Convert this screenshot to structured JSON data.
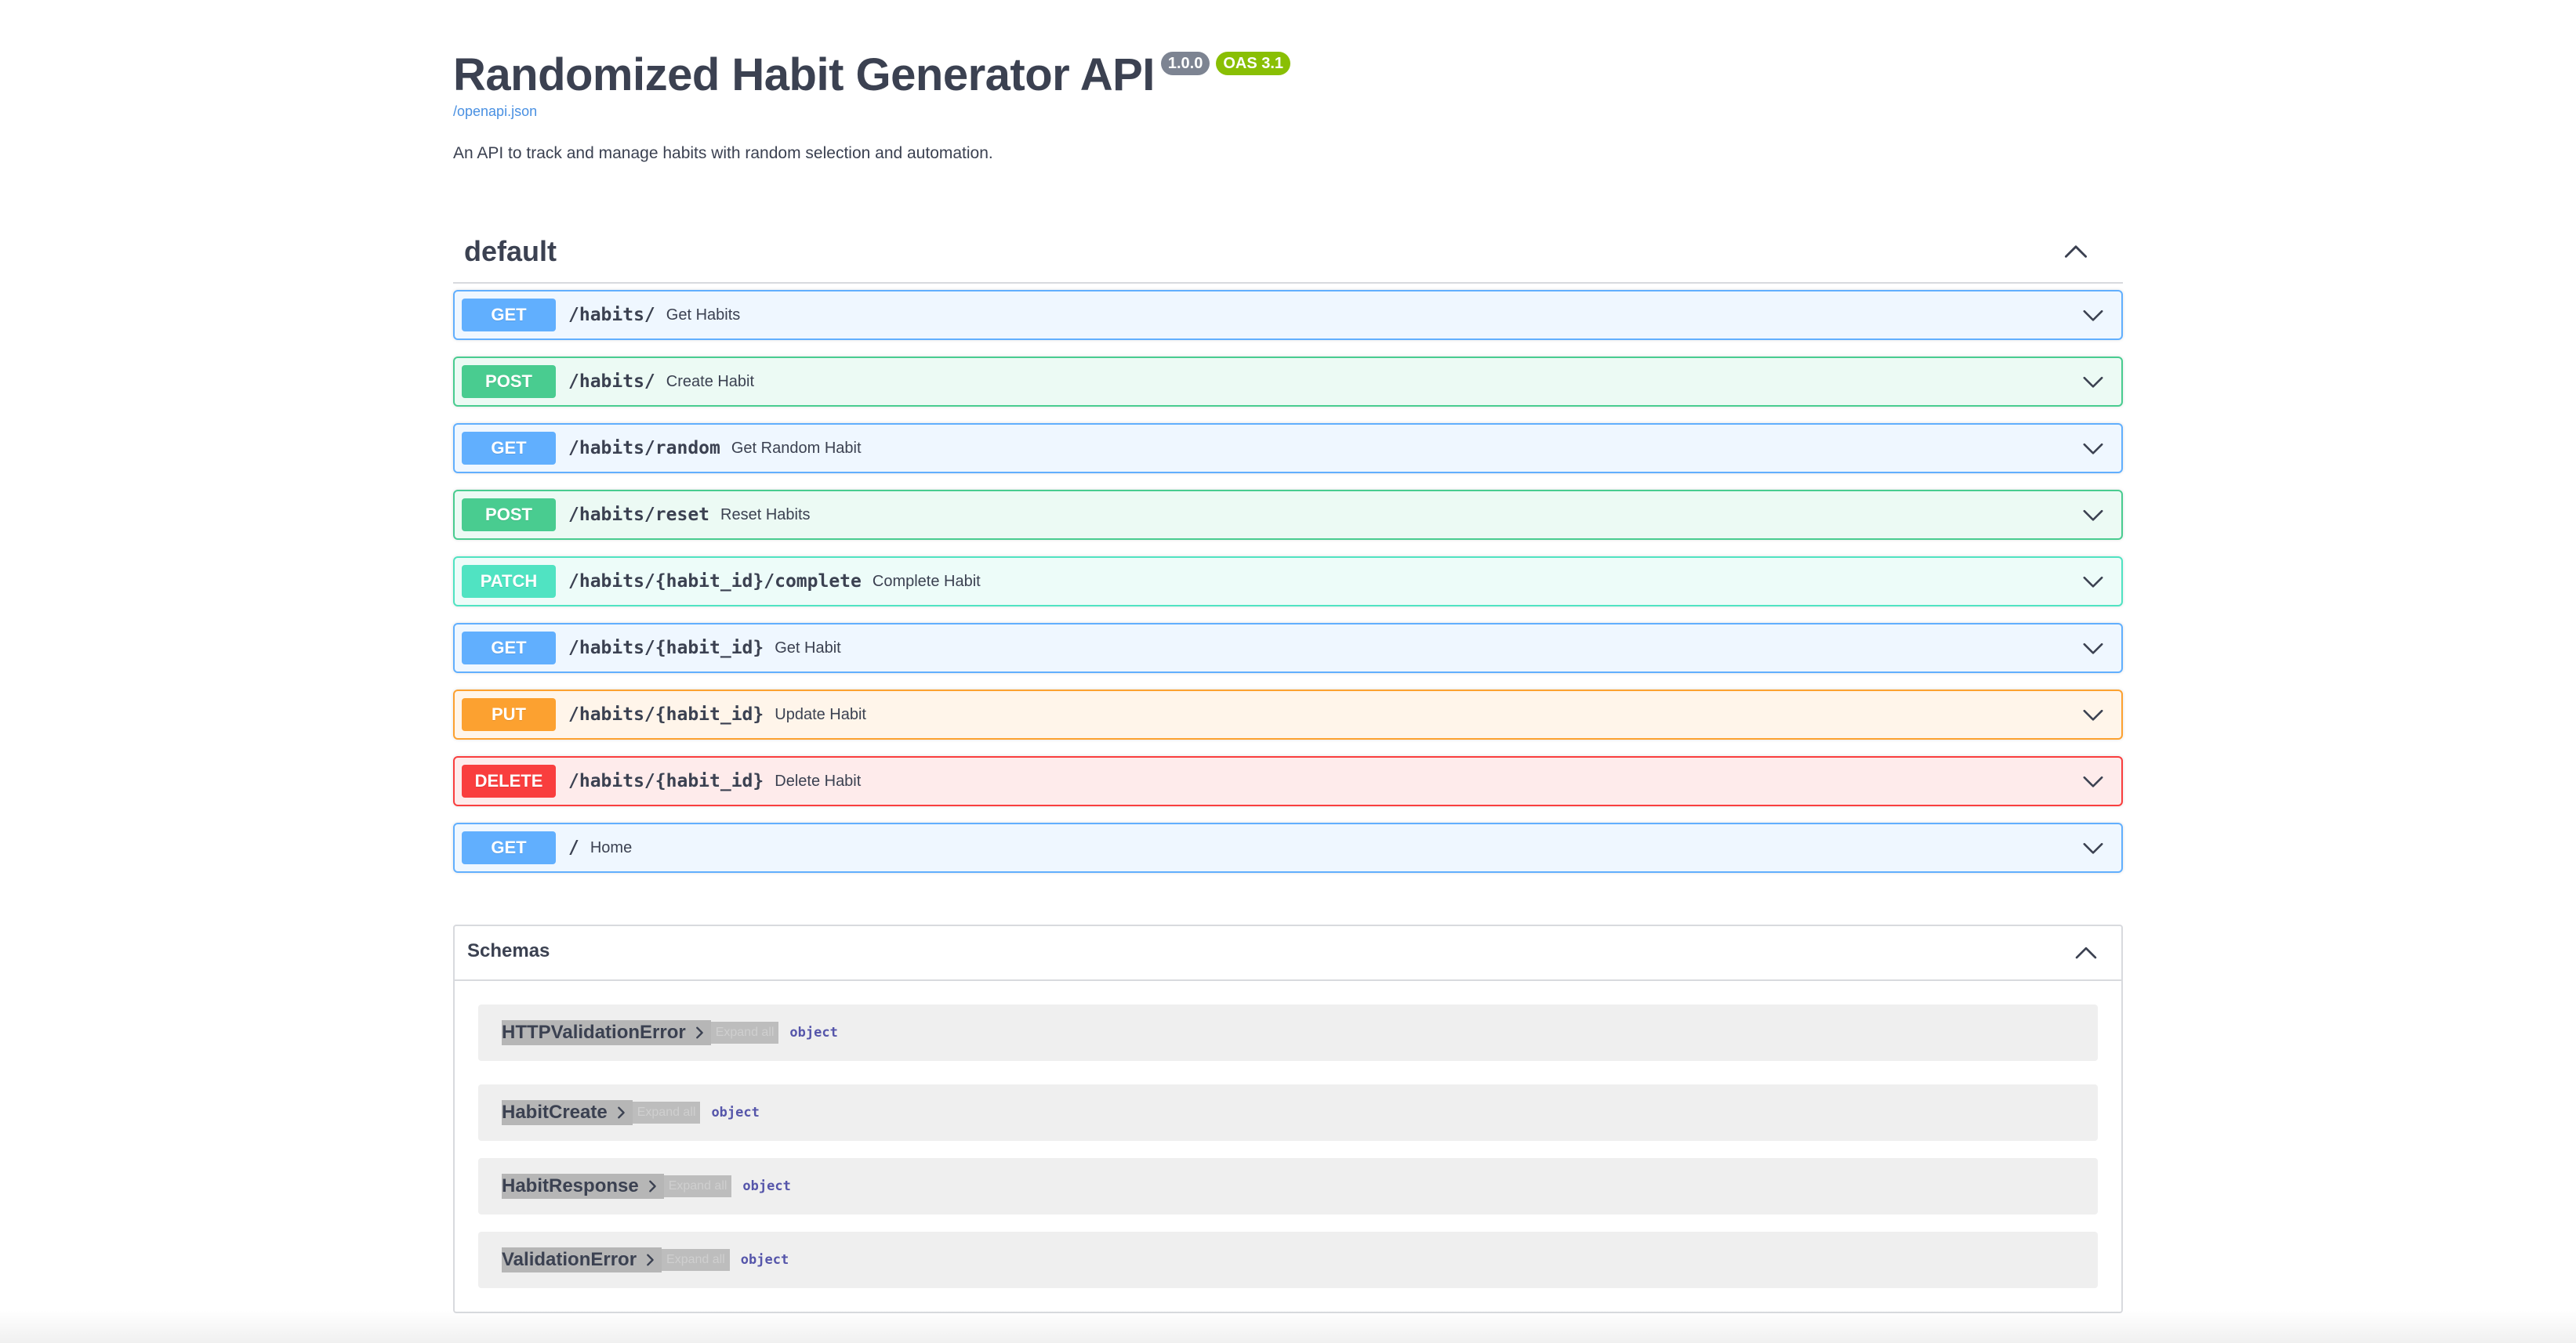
{
  "header": {
    "title": "Randomized Habit Generator API",
    "version_badge": "1.0.0",
    "oas_badge": "OAS 3.1",
    "spec_link": "/openapi.json",
    "description": "An API to track and manage habits with random selection and automation."
  },
  "tag": {
    "name": "default",
    "toggle_icon": "chevron-up-icon"
  },
  "operations": [
    {
      "method": "GET",
      "path": "/habits/",
      "summary": "Get Habits"
    },
    {
      "method": "POST",
      "path": "/habits/",
      "summary": "Create Habit"
    },
    {
      "method": "GET",
      "path": "/habits/random",
      "summary": "Get Random Habit"
    },
    {
      "method": "POST",
      "path": "/habits/reset",
      "summary": "Reset Habits"
    },
    {
      "method": "PATCH",
      "path": "/habits/{habit_id}/complete",
      "summary": "Complete Habit"
    },
    {
      "method": "GET",
      "path": "/habits/{habit_id}",
      "summary": "Get Habit"
    },
    {
      "method": "PUT",
      "path": "/habits/{habit_id}",
      "summary": "Update Habit"
    },
    {
      "method": "DELETE",
      "path": "/habits/{habit_id}",
      "summary": "Delete Habit"
    },
    {
      "method": "GET",
      "path": "/",
      "summary": "Home"
    }
  ],
  "schemas": {
    "title": "Schemas",
    "expand_all_label": "Expand all",
    "models": [
      {
        "name": "HTTPValidationError",
        "type": "object"
      },
      {
        "name": "HabitCreate",
        "type": "object"
      },
      {
        "name": "HabitResponse",
        "type": "object"
      },
      {
        "name": "ValidationError",
        "type": "object"
      }
    ]
  },
  "colors": {
    "GET": "#61affe",
    "POST": "#49cc90",
    "PATCH": "#50e3c2",
    "PUT": "#fca130",
    "DELETE": "#f93e3e",
    "version_badge": "#7d8492",
    "oas_badge": "#89bf04"
  }
}
